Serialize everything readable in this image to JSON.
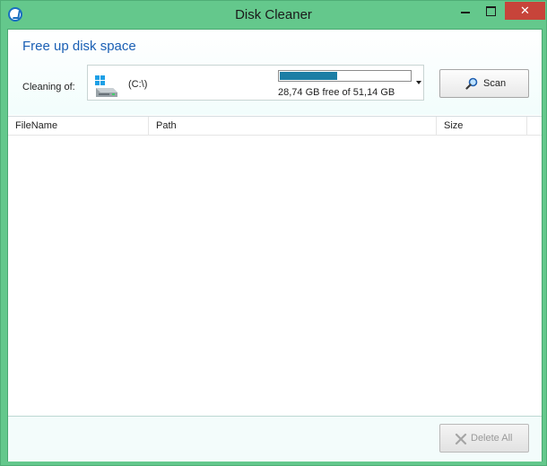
{
  "window": {
    "title": "Disk Cleaner",
    "close_glyph": "✕",
    "icons": {
      "app": "app-logo-icon",
      "minimize": "minimize-icon",
      "maximize": "maximize-icon",
      "close": "close-icon"
    }
  },
  "header": {
    "title": "Free up disk space",
    "cleaning_label": "Cleaning of:"
  },
  "drive": {
    "name": "(C:\\)",
    "free_text": "28,74 GB free of 51,14 GB",
    "used_fraction": 0.44,
    "icon": "drive-icon"
  },
  "scan_button": {
    "label": "Scan",
    "icon": "magnifier-icon"
  },
  "table": {
    "columns": [
      "FileName",
      "Path",
      "Size"
    ],
    "rows": []
  },
  "delete_button": {
    "label": "Delete All",
    "icon": "delete-x-icon",
    "enabled": false
  },
  "colors": {
    "frame": "#64c88c",
    "title_accent": "#1a5fb4",
    "progress": "#1c7ea5",
    "close": "#c7443a"
  }
}
